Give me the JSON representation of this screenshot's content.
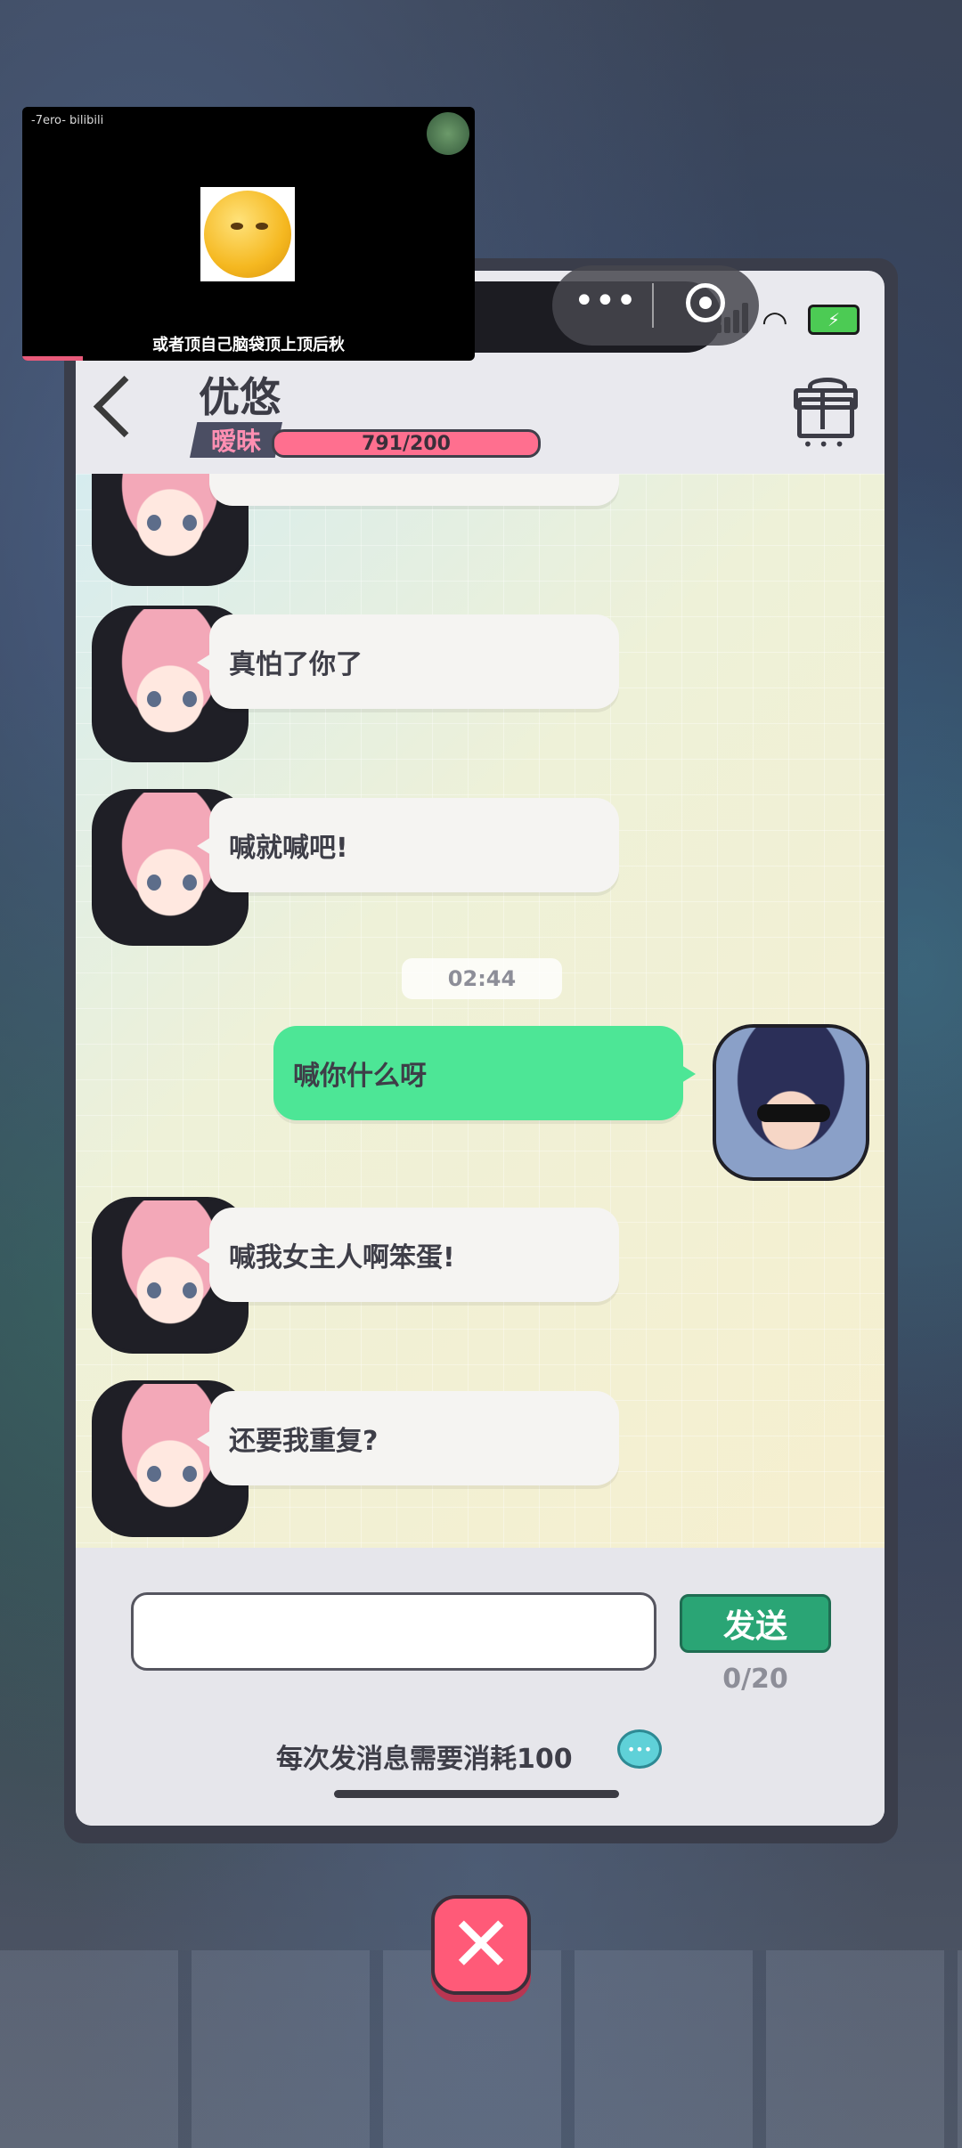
{
  "video": {
    "brand": "-7ero- bilibili",
    "subtitle": "或者顶自己脑袋顶上顶后秋"
  },
  "status_bar": {
    "battery_icon": "battery-charging-icon"
  },
  "header": {
    "contact_name": "优悠",
    "affinity_label": "暧昧",
    "affinity_value": "791/200"
  },
  "messages": [
    {
      "from": "her",
      "text": "真怕了你了"
    },
    {
      "from": "her",
      "text": "喊就喊吧!"
    },
    {
      "from": "me",
      "text": "喊你什么呀"
    },
    {
      "from": "her",
      "text": "喊我女主人啊笨蛋!"
    },
    {
      "from": "her",
      "text": "还要我重复?"
    }
  ],
  "timestamp": "02:44",
  "composer": {
    "placeholder": "",
    "send_label": "发送",
    "char_count": "0/20",
    "cost_note": "每次发消息需要消耗100"
  },
  "colors": {
    "outgoing_bubble": "#4de696",
    "send_button": "#2aa575",
    "affinity_bar": "#ff6f8f",
    "close_button": "#ff5a78"
  }
}
